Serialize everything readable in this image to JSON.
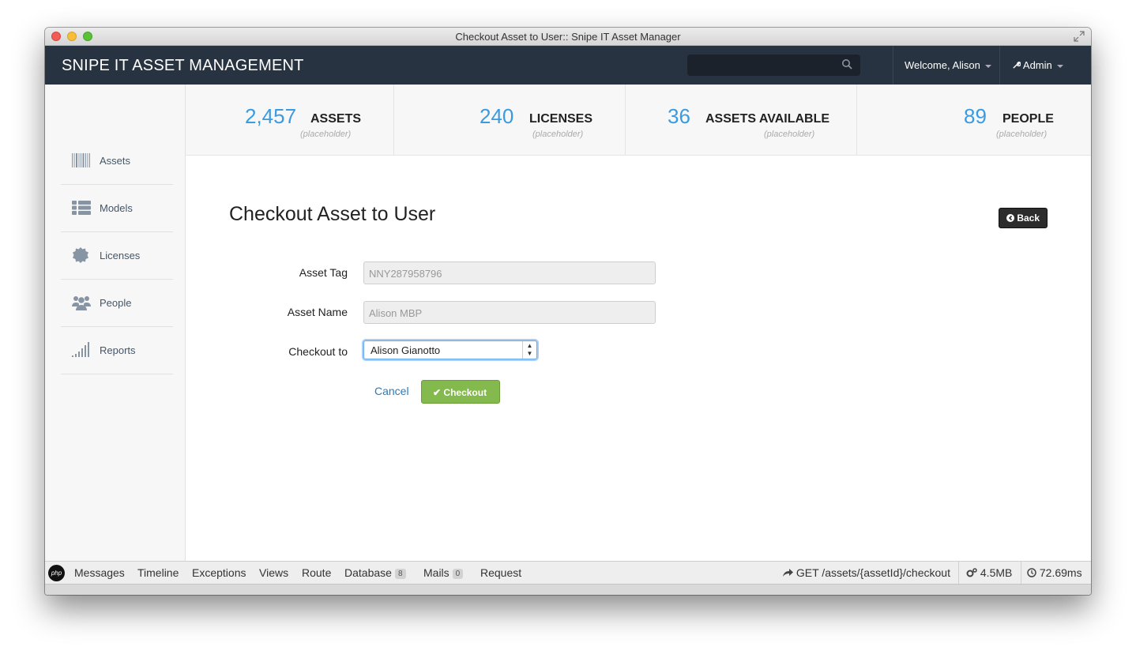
{
  "window": {
    "title": "Checkout Asset to User:: Snipe IT Asset Manager"
  },
  "navbar": {
    "brand": "SNIPE IT ASSET MANAGEMENT",
    "search_value": "",
    "welcome": "Welcome, Alison",
    "admin": "Admin"
  },
  "sidebar": {
    "items": [
      {
        "label": "Assets",
        "icon": "barcode-icon"
      },
      {
        "label": "Models",
        "icon": "list-icon"
      },
      {
        "label": "Licenses",
        "icon": "certificate-icon"
      },
      {
        "label": "People",
        "icon": "group-icon"
      },
      {
        "label": "Reports",
        "icon": "signal-icon"
      }
    ]
  },
  "stats": [
    {
      "number": "2,457",
      "label": "ASSETS",
      "sub": "(placeholder)"
    },
    {
      "number": "240",
      "label": "LICENSES",
      "sub": "(placeholder)"
    },
    {
      "number": "36",
      "label": "ASSETS AVAILABLE",
      "sub": "(placeholder)"
    },
    {
      "number": "89",
      "label": "PEOPLE",
      "sub": "(placeholder)"
    }
  ],
  "page": {
    "title": "Checkout Asset to User",
    "back_label": "Back"
  },
  "form": {
    "asset_tag_label": "Asset Tag",
    "asset_tag_value": "NNY287958796",
    "asset_name_label": "Asset Name",
    "asset_name_value": "Alison MBP",
    "checkout_to_label": "Checkout to",
    "checkout_to_value": "Alison Gianotto",
    "cancel_label": "Cancel",
    "checkout_label": "Checkout"
  },
  "debugbar": {
    "messages": "Messages",
    "timeline": "Timeline",
    "exceptions": "Exceptions",
    "views": "Views",
    "route": "Route",
    "database": "Database",
    "database_count": "8",
    "mails": "Mails",
    "mails_count": "0",
    "request": "Request",
    "route_info": "GET /assets/{assetId}/checkout",
    "memory": "4.5MB",
    "time": "72.69ms"
  },
  "colors": {
    "navbar": "#283341",
    "accent": "#3a9be0",
    "success": "#84b94e"
  }
}
